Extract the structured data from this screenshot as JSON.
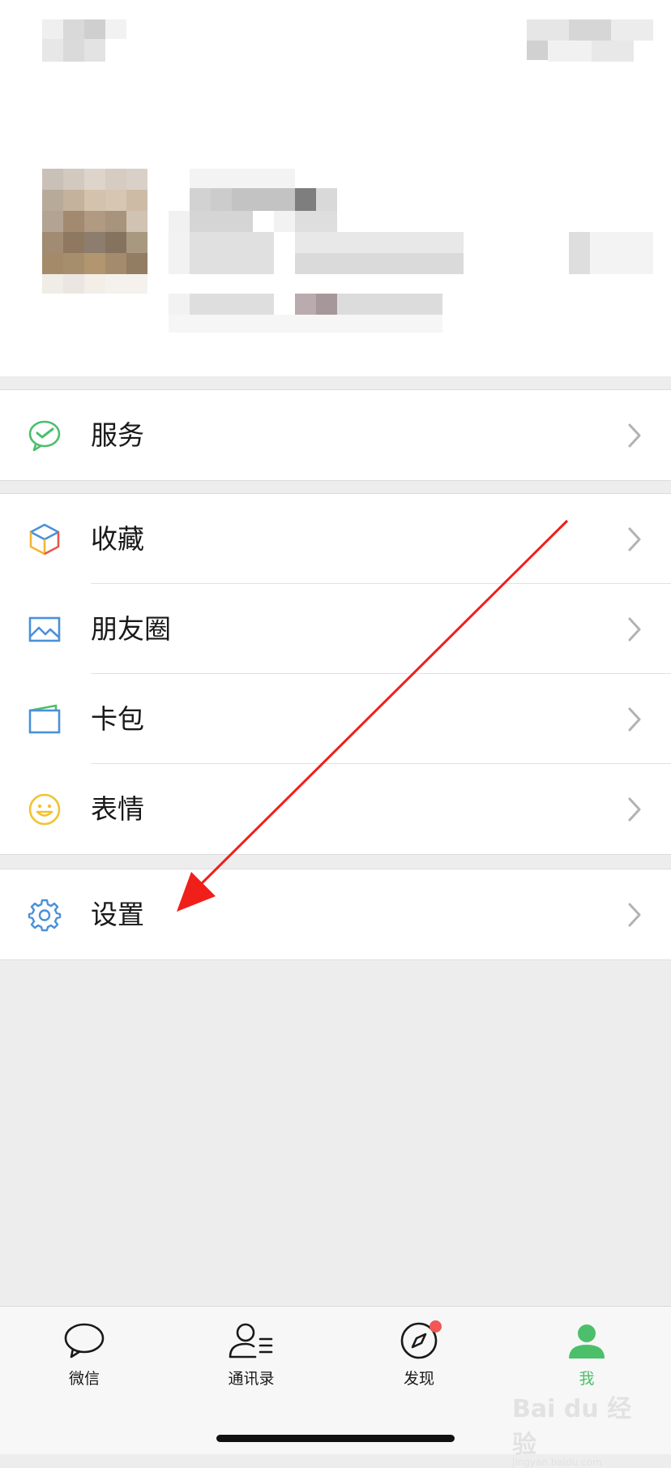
{
  "menu": {
    "services": {
      "label": "服务"
    },
    "favorites": {
      "label": "收藏"
    },
    "moments": {
      "label": "朋友圈"
    },
    "cards": {
      "label": "卡包"
    },
    "stickers": {
      "label": "表情"
    },
    "settings": {
      "label": "设置"
    }
  },
  "tabbar": {
    "chats": {
      "label": "微信"
    },
    "contacts": {
      "label": "通讯录"
    },
    "discover": {
      "label": "发现",
      "badge": true
    },
    "me": {
      "label": "我",
      "active": true
    }
  },
  "watermark": {
    "text": "Bai du 经验",
    "subtext": "jingyan.baidu.com"
  },
  "colors": {
    "accent_green": "#4cbf6a",
    "annotation_red": "#f01f1a",
    "background": "#ededed",
    "badge_red": "#f25656"
  },
  "icons": {
    "services": "wechat-pay-icon",
    "favorites": "cube-icon",
    "moments": "picture-icon",
    "cards": "card-wallet-icon",
    "stickers": "smiley-icon",
    "settings": "gear-icon"
  }
}
